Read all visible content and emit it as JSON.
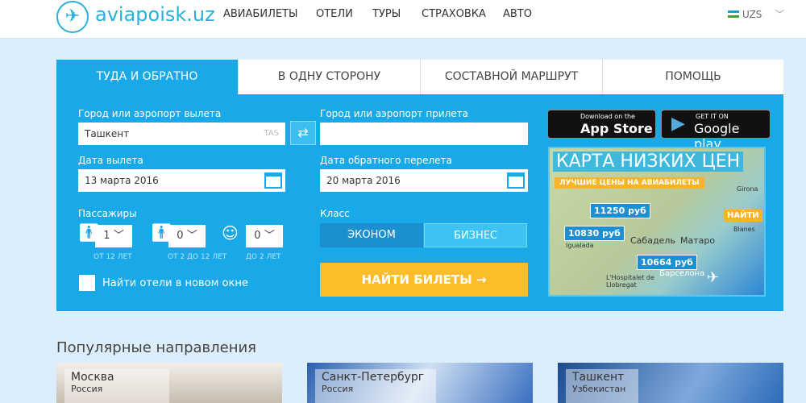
{
  "header": {
    "logo": "aviapoisk.uz",
    "nav": [
      "АВИАБИЛЕТЫ",
      "ОТЕЛИ",
      "ТУРЫ",
      "СТРАХОВКА",
      "АВТО"
    ],
    "currency": "UZS"
  },
  "tabs": [
    "ТУДА И ОБРАТНО",
    "В ОДНУ СТОРОНУ",
    "СОСТАВНОЙ МАРШРУТ",
    "ПОМОЩЬ"
  ],
  "form": {
    "from_label": "Город или аэропорт вылета",
    "from_value": "Ташкент",
    "from_code": "TAS",
    "to_label": "Город или аэропорт прилета",
    "to_value": "",
    "depart_label": "Дата вылета",
    "depart_value": "13 марта 2016",
    "return_label": "Дата обратного перелета",
    "return_value": "20 марта 2016",
    "passengers_label": "Пассажиры",
    "adults": "1",
    "children": "0",
    "infants": "0",
    "adults_note": "ОТ 12 ЛЕТ",
    "children_note": "ОТ 2 ДО 12 ЛЕТ",
    "infants_note": "ДО 2 ЛЕТ",
    "class_label": "Класс",
    "class_options": [
      "ЭКОНОМ",
      "БИЗНЕС"
    ],
    "hotel_checkbox": "Найти отели в новом окне",
    "search_button": "НАЙТИ БИЛЕТЫ"
  },
  "apps": {
    "appstore_small": "Download on the",
    "appstore": "App Store",
    "google_small": "GET IT ON",
    "google": "Google play"
  },
  "map": {
    "title": "КАРТА НИЗКИХ ЦЕН",
    "subtitle": "ЛУЧШИЕ ЦЕНЫ НА АВИАБИЛЕТЫ",
    "prices": [
      "11250 руб",
      "10830 руб",
      "10664 руб"
    ],
    "find": "НАЙТИ",
    "cities": [
      "Сабадель",
      "Матаро",
      "Барселона",
      "L'Hospitalet de Llobregat",
      "Igualada",
      "Blanes",
      "Girona"
    ]
  },
  "popular": {
    "title": "Популярные направления",
    "cards": [
      {
        "city": "Москва",
        "country": "Россия"
      },
      {
        "city": "Санкт-Петербург",
        "country": "Россия"
      },
      {
        "city": "Ташкент",
        "country": "Узбекистан"
      }
    ]
  },
  "colors": {
    "panel": "#1aa9e8",
    "button": "#fbbd2a",
    "page": "#dcedfb"
  }
}
